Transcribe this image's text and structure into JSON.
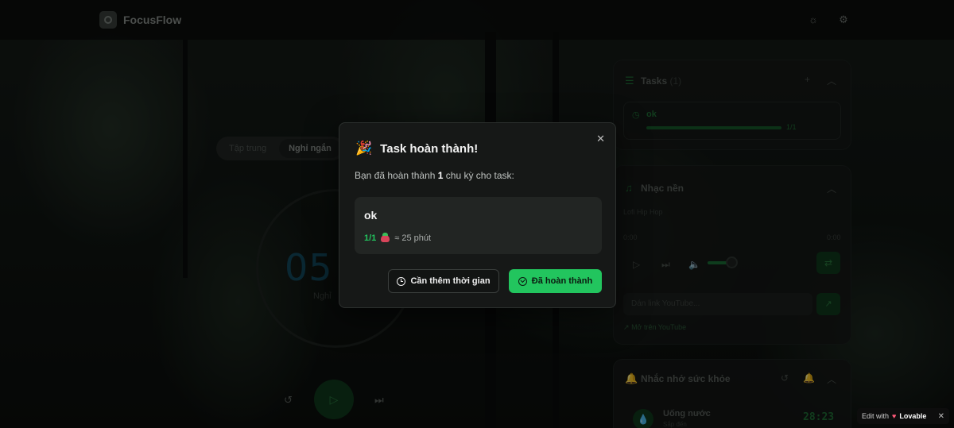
{
  "app": {
    "name": "FocusFlow"
  },
  "topbar": {
    "theme_icon": "sun-icon",
    "settings_icon": "gear-icon"
  },
  "timer": {
    "modes": [
      "Tập trung",
      "Nghỉ ngắn"
    ],
    "active_mode": "Nghỉ ngắn",
    "time_partial": "05",
    "sub_partial": "Nghỉ"
  },
  "tasks_panel": {
    "title": "Tasks",
    "count": "(1)",
    "item": {
      "name": "ok",
      "progress": "1/1"
    }
  },
  "music_panel": {
    "title": "Nhạc nền",
    "track": "Lofi Hip Hop",
    "time_current": "0:00",
    "time_total": "0:00",
    "youtube_placeholder": "Dán link YouTube...",
    "open_youtube": "Mở trên YouTube"
  },
  "health_panel": {
    "title": "Nhắc nhở sức khỏe",
    "item": {
      "name": "Uống nước",
      "status": "Sắp đến",
      "countdown": "28:23"
    }
  },
  "lovable_badge": {
    "prefix": "Edit with",
    "brand": "Lovable",
    "close": "✕"
  },
  "modal": {
    "icon": "🎉",
    "title": "Task hoàn thành!",
    "desc_before": "Bạn đã hoàn thành ",
    "desc_count": "1",
    "desc_after": " chu kỳ cho task:",
    "task": {
      "name": "ok",
      "progress": "1/1",
      "duration": "≈ 25 phút"
    },
    "btn_more_time": "Cần thêm thời gian",
    "btn_done": "Đã hoàn thành",
    "close": "✕",
    "accent": "#22c55e"
  }
}
